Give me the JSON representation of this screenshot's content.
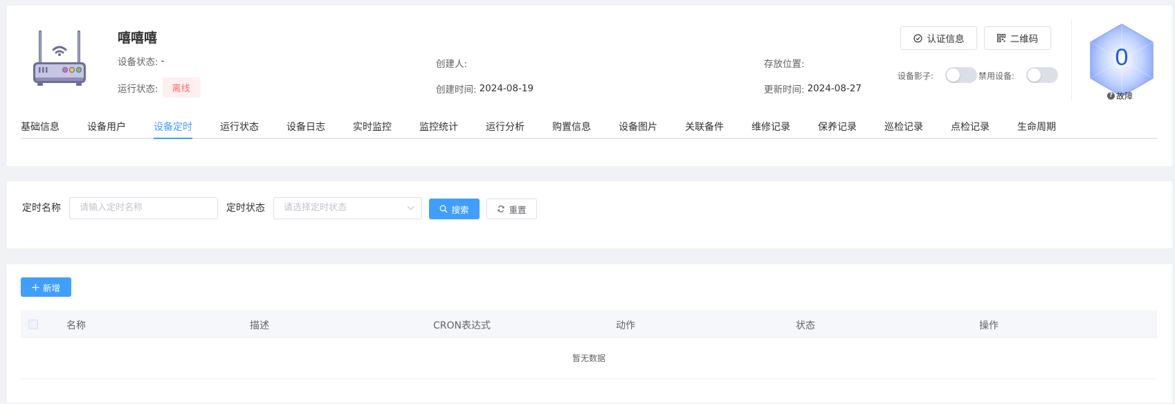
{
  "device": {
    "name": "嘻嘻嘻",
    "device_status_label": "设备状态:",
    "device_status_value": "-",
    "run_status_label": "运行状态:",
    "run_status_value": "离线",
    "creator_label": "创建人:",
    "creator_value": "",
    "created_label": "创建时间:",
    "created_value": "2024-08-19",
    "location_label": "存放位置:",
    "location_value": "",
    "updated_label": "更新时间:",
    "updated_value": "2024-08-27"
  },
  "actions": {
    "cert_label": "认证信息",
    "qrcode_label": "二维码",
    "shadow_label": "设备影子:",
    "disable_label": "禁用设备:"
  },
  "score": {
    "value": "0",
    "status": "故障",
    "color": "#1f57e6"
  },
  "tabs": [
    {
      "label": "基础信息"
    },
    {
      "label": "设备用户"
    },
    {
      "label": "设备定时"
    },
    {
      "label": "运行状态"
    },
    {
      "label": "设备日志"
    },
    {
      "label": "实时监控"
    },
    {
      "label": "监控统计"
    },
    {
      "label": "运行分析"
    },
    {
      "label": "购置信息"
    },
    {
      "label": "设备图片"
    },
    {
      "label": "关联备件"
    },
    {
      "label": "维修记录"
    },
    {
      "label": "保养记录"
    },
    {
      "label": "巡检记录"
    },
    {
      "label": "点检记录"
    },
    {
      "label": "生命周期"
    }
  ],
  "active_tab": "设备定时",
  "search": {
    "name_label": "定时名称",
    "name_placeholder": "请输入定时名称",
    "status_label": "定时状态",
    "status_placeholder": "请选择定时状态",
    "search_button": "搜索",
    "reset_button": "重置"
  },
  "table": {
    "add_button": "新增",
    "columns": [
      "名称",
      "描述",
      "CRON表达式",
      "动作",
      "状态",
      "操作"
    ],
    "empty_text": "暂无数据"
  },
  "colors": {
    "primary": "#409eff",
    "danger": "#f56c6c"
  }
}
